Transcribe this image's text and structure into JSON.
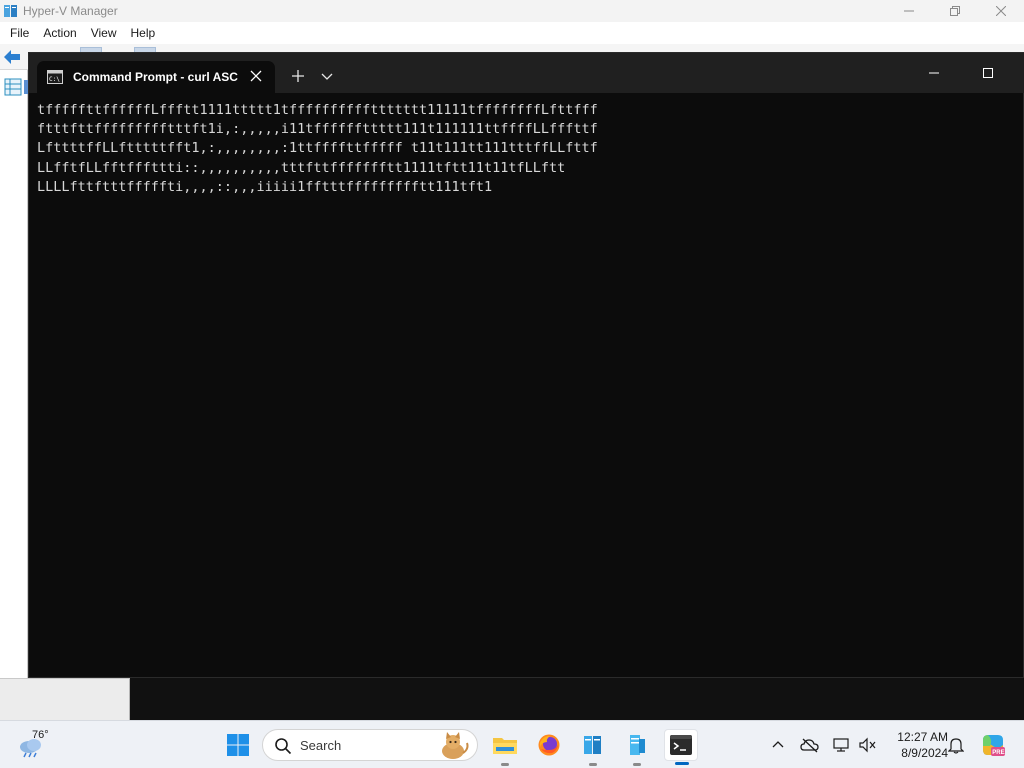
{
  "hyperv": {
    "title": "Hyper-V Manager",
    "menu": [
      "File",
      "Action",
      "View",
      "Help"
    ]
  },
  "terminal": {
    "tab_title": "Command Prompt - curl  ASC",
    "lines": [
      "tfffffttffffffLffftt1111ttttt1tffffffffffttttttt11111tffffffffLfttfff",
      "ftttfttffffffffftttft1i,:,,,,,i11tffffffttttt111t111111ttffffLLfffttf",
      "LfttttffLLftttttfft1,:,,,,,,,,:1ttffffttfffff t11t111tt111tttffLLfttf",
      "LLfftfLLfftfffttti::,,,,,,,,,,tttfttffffffftt1111tftt11t11tfLLftt",
      "LLLLfttftttfffffti,,,,::,,,iiiii1fftttffffffffftt111tft1"
    ]
  },
  "taskbar": {
    "weather_temp": "76°",
    "search_label": "Search",
    "apps": [
      "file-explorer",
      "firefox",
      "hyper-v-manager",
      "hyper-v-manager-2",
      "windows-terminal"
    ],
    "clock_time": "12:27 AM",
    "clock_date": "8/9/2024"
  },
  "colors": {
    "terminal_bg": "#0c0c0c",
    "terminal_text": "#d8d8d8",
    "tabbar_bg": "#202020",
    "taskbar_bg": "#eef1f6",
    "accent": "#0067c0"
  }
}
